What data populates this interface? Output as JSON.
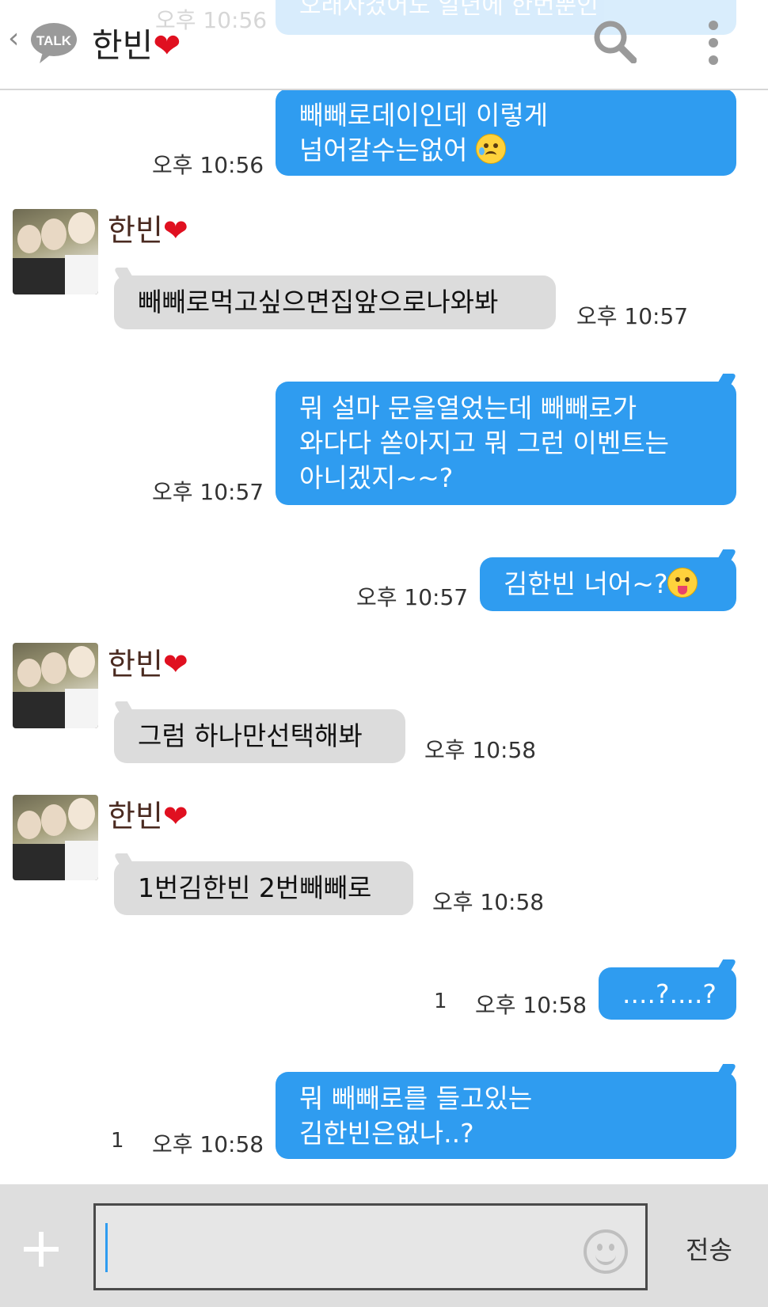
{
  "header": {
    "ghost_time": "오후 10:56",
    "ghost_text": "오래사겼어도 일년에 한번뿐인",
    "title": "한빈",
    "heart": "❤",
    "logo_text": "TALK",
    "icons": [
      "back-icon",
      "talk-logo-icon",
      "search-icon",
      "more-menu-icon"
    ]
  },
  "messages": [
    {
      "dir": "out",
      "lines": [
        "빼빼로데이인데 이렇게",
        "넘어갈수는없어"
      ],
      "emoji": "crying-emoji-icon",
      "time": "오후 10:56"
    },
    {
      "dir": "in",
      "sender": "한빈",
      "heart": "❤",
      "lines": [
        "빼빼로먹고싶으면집앞으로나와봐"
      ],
      "time": "오후 10:57"
    },
    {
      "dir": "out",
      "lines": [
        "뭐 설마 문을열었는데 빼빼로가",
        "와다다 쏟아지고 뭐 그런 이벤트는",
        "아니겠지~~?"
      ],
      "time": "오후 10:57"
    },
    {
      "dir": "out",
      "lines": [
        "김한빈 너어~?"
      ],
      "emoji": "tongue-emoji-icon",
      "time": "오후 10:57"
    },
    {
      "dir": "in",
      "sender": "한빈",
      "heart": "❤",
      "lines": [
        "그럼 하나만선택해봐"
      ],
      "time": "오후 10:58"
    },
    {
      "dir": "in",
      "sender": "한빈",
      "heart": "❤",
      "lines": [
        "1번김한빈 2번빼빼로"
      ],
      "time": "오후 10:58"
    },
    {
      "dir": "out",
      "lines": [
        "....?....?"
      ],
      "time": "오후 10:58",
      "unread": "1"
    },
    {
      "dir": "out",
      "lines": [
        "뭐 빼빼로를 들고있는",
        "김한빈은없나..?"
      ],
      "time": "오후 10:58",
      "unread": "1"
    }
  ],
  "input": {
    "value": "",
    "send_label": "전송"
  },
  "colors": {
    "outgoing_bubble": "#2f9cf0",
    "incoming_bubble": "#dcdcdc",
    "heart": "#e01020",
    "input_bar": "#dedede"
  }
}
